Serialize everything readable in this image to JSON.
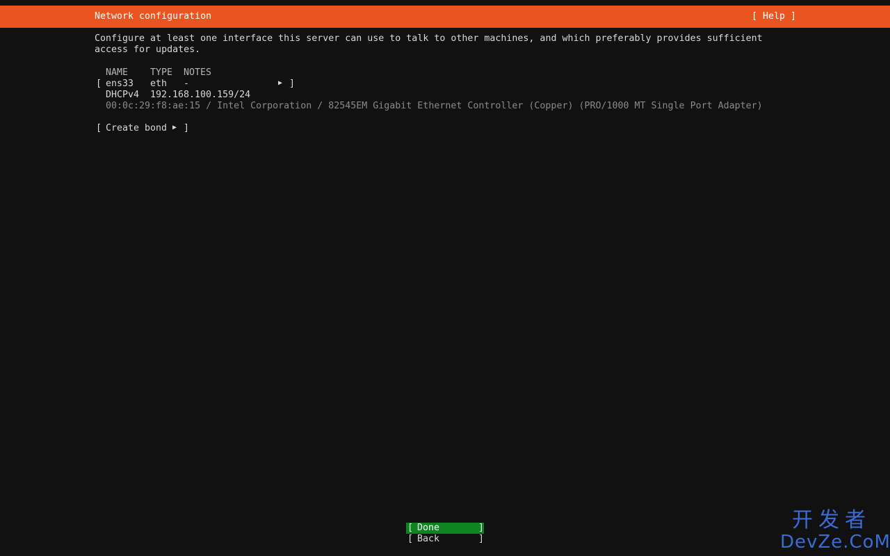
{
  "header": {
    "title": "Network configuration",
    "help_label": "[ Help ]"
  },
  "description": "Configure at least one interface this server can use to talk to other machines, and which preferably provides sufficient access for updates.",
  "table": {
    "columns": [
      "NAME",
      "TYPE",
      "NOTES"
    ],
    "interfaces": [
      {
        "name": "ens33",
        "type": "eth",
        "notes": "-",
        "address_method": "DHCPv4",
        "address": "192.168.100.159/24",
        "hardware": "00:0c:29:f8:ae:15 / Intel Corporation / 82545EM Gigabit Ethernet Controller (Copper) (PRO/1000 MT Single Port Adapter)"
      }
    ]
  },
  "actions": {
    "create_bond": "Create bond"
  },
  "footer": {
    "done_label": "Done",
    "back_label": "Back"
  },
  "watermark": {
    "top": "开发者",
    "bottom": "DevZe.CoM"
  },
  "colors": {
    "header_bg": "#e95420",
    "done_bg": "#0e8420",
    "background": "#111111"
  }
}
